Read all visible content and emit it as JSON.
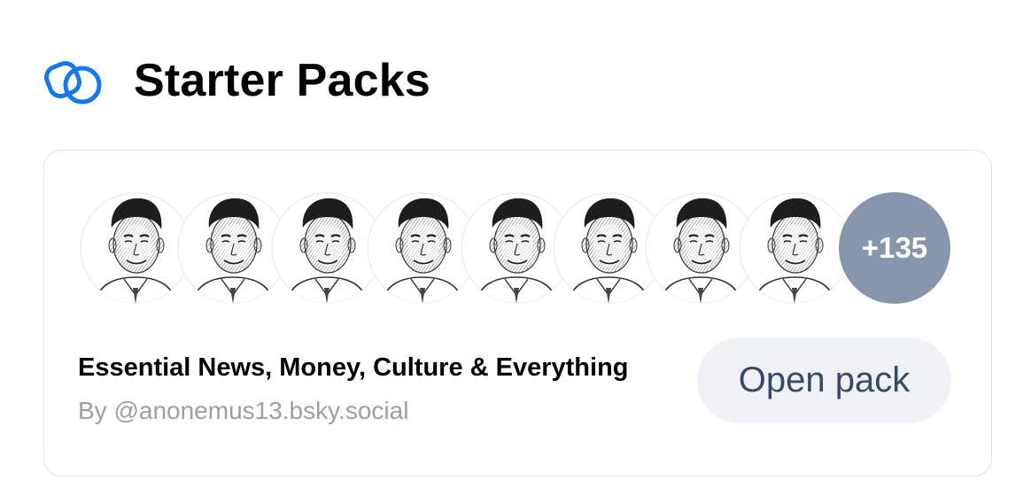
{
  "section": {
    "title": "Starter Packs",
    "icon": "starter-packs-icon",
    "accent_color": "#1677f0"
  },
  "pack": {
    "title": "Essential News, Money, Culture & Everything",
    "author": "By @anonemus13.bsky.social",
    "avatar_count_shown": 8,
    "more_label": "+135",
    "more_badge_color": "#8896ad",
    "open_button_label": "Open pack"
  }
}
